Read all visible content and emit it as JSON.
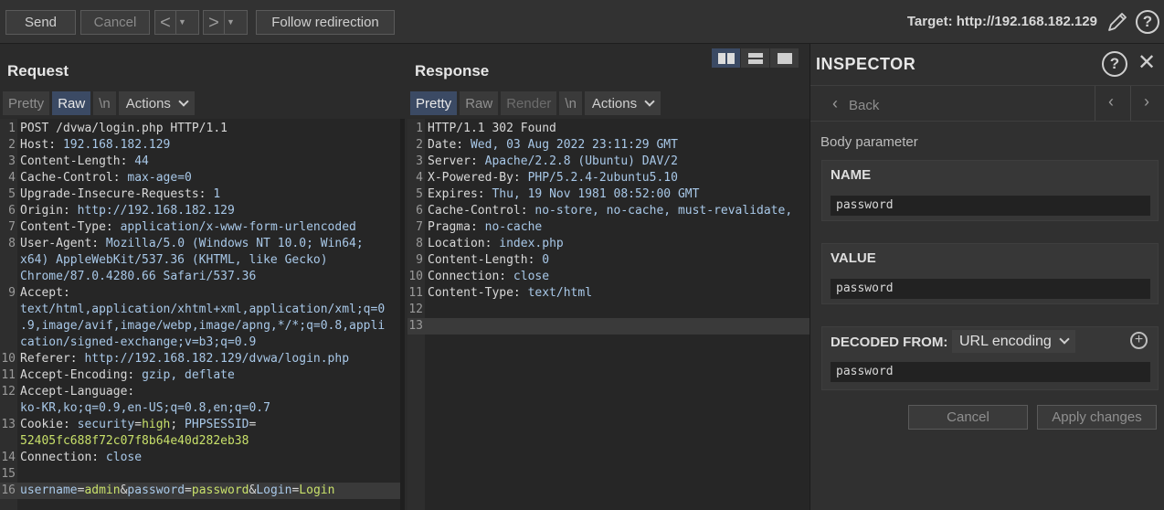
{
  "toolbar": {
    "send": "Send",
    "cancel": "Cancel",
    "back_arrow": "<",
    "forward_arrow": ">",
    "dropdown": "▼",
    "follow": "Follow redirection",
    "target": "Target: http://192.168.182.129"
  },
  "request": {
    "title": "Request",
    "tabs": {
      "pretty": "Pretty",
      "raw": "Raw",
      "newline": "\\n",
      "actions": "Actions"
    },
    "lines": [
      {
        "n": "1",
        "parts": [
          [
            "k",
            "POST /dvwa/login.php HTTP/1.1"
          ]
        ]
      },
      {
        "n": "2",
        "parts": [
          [
            "k",
            "Host: "
          ],
          [
            "v",
            "192.168.182.129"
          ]
        ]
      },
      {
        "n": "3",
        "parts": [
          [
            "k",
            "Content-Length: "
          ],
          [
            "v",
            "44"
          ]
        ]
      },
      {
        "n": "4",
        "parts": [
          [
            "k",
            "Cache-Control: "
          ],
          [
            "v",
            "max-age=0"
          ]
        ]
      },
      {
        "n": "5",
        "parts": [
          [
            "k",
            "Upgrade-Insecure-Requests: "
          ],
          [
            "v",
            "1"
          ]
        ]
      },
      {
        "n": "6",
        "parts": [
          [
            "k",
            "Origin: "
          ],
          [
            "v",
            "http://192.168.182.129"
          ]
        ]
      },
      {
        "n": "7",
        "parts": [
          [
            "k",
            "Content-Type: "
          ],
          [
            "v",
            "application/x-www-form-urlencoded"
          ]
        ]
      },
      {
        "n": "8",
        "parts": [
          [
            "k",
            "User-Agent: "
          ],
          [
            "v",
            "Mozilla/5.0 (Windows NT 10.0; Win64;"
          ]
        ]
      },
      {
        "n": "",
        "parts": [
          [
            "v",
            "x64) AppleWebKit/537.36 (KHTML, like Gecko)"
          ]
        ]
      },
      {
        "n": "",
        "parts": [
          [
            "v",
            "Chrome/87.0.4280.66 Safari/537.36"
          ]
        ]
      },
      {
        "n": "9",
        "parts": [
          [
            "k",
            "Accept:"
          ]
        ]
      },
      {
        "n": "",
        "parts": [
          [
            "v",
            "text/html,application/xhtml+xml,application/xml;q=0"
          ]
        ]
      },
      {
        "n": "",
        "parts": [
          [
            "v",
            ".9,image/avif,image/webp,image/apng,*/*;q=0.8,appli"
          ]
        ]
      },
      {
        "n": "",
        "parts": [
          [
            "v",
            "cation/signed-exchange;v=b3;q=0.9"
          ]
        ]
      },
      {
        "n": "10",
        "parts": [
          [
            "k",
            "Referer: "
          ],
          [
            "v",
            "http://192.168.182.129/dvwa/login.php"
          ]
        ]
      },
      {
        "n": "11",
        "parts": [
          [
            "k",
            "Accept-Encoding: "
          ],
          [
            "v",
            "gzip, deflate"
          ]
        ]
      },
      {
        "n": "12",
        "parts": [
          [
            "k",
            "Accept-Language:"
          ]
        ]
      },
      {
        "n": "",
        "parts": [
          [
            "v",
            "ko-KR,ko;q=0.9,en-US;q=0.8,en;q=0.7"
          ]
        ]
      },
      {
        "n": "13",
        "parts": [
          [
            "k",
            "Cookie: "
          ],
          [
            "v",
            "security"
          ],
          [
            "k",
            "="
          ],
          [
            "c",
            "high"
          ],
          [
            "k",
            "; "
          ],
          [
            "v",
            "PHPSESSID"
          ],
          [
            "k",
            "="
          ]
        ]
      },
      {
        "n": "",
        "parts": [
          [
            "c",
            "52405fc688f72c07f8b64e40d282eb38"
          ]
        ]
      },
      {
        "n": "14",
        "parts": [
          [
            "k",
            "Connection: "
          ],
          [
            "v",
            "close"
          ]
        ]
      },
      {
        "n": "15",
        "parts": [
          [
            "k",
            ""
          ]
        ]
      },
      {
        "n": "16",
        "hl": true,
        "parts": [
          [
            "v",
            "username"
          ],
          [
            "k",
            "="
          ],
          [
            "c",
            "admin"
          ],
          [
            "k",
            "&"
          ],
          [
            "v",
            "password"
          ],
          [
            "k",
            "="
          ],
          [
            "c",
            "password"
          ],
          [
            "k",
            "&"
          ],
          [
            "v",
            "Login"
          ],
          [
            "k",
            "="
          ],
          [
            "c",
            "Login"
          ]
        ]
      }
    ]
  },
  "response": {
    "title": "Response",
    "tabs": {
      "pretty": "Pretty",
      "raw": "Raw",
      "render": "Render",
      "newline": "\\n",
      "actions": "Actions"
    },
    "lines": [
      {
        "n": "1",
        "parts": [
          [
            "k",
            "HTTP/1.1 302 Found"
          ]
        ]
      },
      {
        "n": "2",
        "parts": [
          [
            "k",
            "Date: "
          ],
          [
            "v",
            "Wed, 03 Aug 2022 23:11:29 GMT"
          ]
        ]
      },
      {
        "n": "3",
        "parts": [
          [
            "k",
            "Server: "
          ],
          [
            "v",
            "Apache/2.2.8 (Ubuntu) DAV/2"
          ]
        ]
      },
      {
        "n": "4",
        "parts": [
          [
            "k",
            "X-Powered-By: "
          ],
          [
            "v",
            "PHP/5.2.4-2ubuntu5.10"
          ]
        ]
      },
      {
        "n": "5",
        "parts": [
          [
            "k",
            "Expires: "
          ],
          [
            "v",
            "Thu, 19 Nov 1981 08:52:00 GMT"
          ]
        ]
      },
      {
        "n": "6",
        "parts": [
          [
            "k",
            "Cache-Control: "
          ],
          [
            "v",
            "no-store, no-cache, must-revalidate,"
          ]
        ]
      },
      {
        "n": "7",
        "parts": [
          [
            "k",
            "Pragma: "
          ],
          [
            "v",
            "no-cache"
          ]
        ]
      },
      {
        "n": "8",
        "parts": [
          [
            "k",
            "Location: "
          ],
          [
            "v",
            "index.php"
          ]
        ]
      },
      {
        "n": "9",
        "parts": [
          [
            "k",
            "Content-Length: "
          ],
          [
            "v",
            "0"
          ]
        ]
      },
      {
        "n": "10",
        "parts": [
          [
            "k",
            "Connection: "
          ],
          [
            "v",
            "close"
          ]
        ]
      },
      {
        "n": "11",
        "parts": [
          [
            "k",
            "Content-Type: "
          ],
          [
            "v",
            "text/html"
          ]
        ]
      },
      {
        "n": "12",
        "parts": [
          [
            "k",
            ""
          ]
        ]
      },
      {
        "n": "13",
        "hl": true,
        "parts": [
          [
            "k",
            ""
          ]
        ]
      }
    ]
  },
  "inspector": {
    "title": "INSPECTOR",
    "help": "?",
    "close": "✕",
    "back": "Back",
    "section": "Body parameter",
    "name_label": "NAME",
    "name_value": "password",
    "value_label": "VALUE",
    "value_value": "password",
    "decoded_label": "DECODED FROM:",
    "decoded_option": "URL encoding",
    "decoded_value": "password",
    "cancel": "Cancel",
    "apply": "Apply changes"
  },
  "colors": {
    "accent_tab": "#3b4a64",
    "param_value": "#c8e06a",
    "header_value": "#a8c8e8"
  }
}
